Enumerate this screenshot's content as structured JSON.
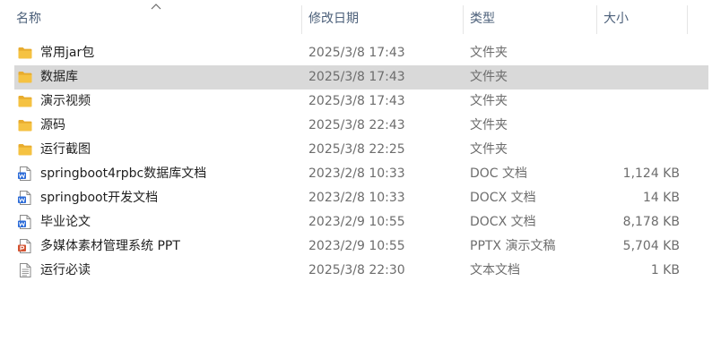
{
  "columns": {
    "name": "名称",
    "date": "修改日期",
    "type": "类型",
    "size": "大小"
  },
  "sort": {
    "column": "name",
    "direction": "ascending"
  },
  "colors": {
    "folder": "#f5c242",
    "word": "#2b6bd8",
    "ppt": "#d35230",
    "selected_row": "#d9d9d9",
    "header_text": "#4c607a"
  },
  "files": [
    {
      "name": "常用jar包",
      "date": "2025/3/8 17:43",
      "type": "文件夹",
      "size": "",
      "icon": "folder-icon",
      "selected": false
    },
    {
      "name": "数据库",
      "date": "2025/3/8 17:43",
      "type": "文件夹",
      "size": "",
      "icon": "folder-icon",
      "selected": true
    },
    {
      "name": "演示视频",
      "date": "2025/3/8 17:43",
      "type": "文件夹",
      "size": "",
      "icon": "folder-icon",
      "selected": false
    },
    {
      "name": "源码",
      "date": "2025/3/8 22:43",
      "type": "文件夹",
      "size": "",
      "icon": "folder-icon",
      "selected": false
    },
    {
      "name": "运行截图",
      "date": "2025/3/8 22:25",
      "type": "文件夹",
      "size": "",
      "icon": "folder-icon",
      "selected": false
    },
    {
      "name": "springboot4rpbc数据库文档",
      "date": "2023/2/8 10:33",
      "type": "DOC 文档",
      "size": "1,124 KB",
      "icon": "word-doc-icon",
      "selected": false
    },
    {
      "name": "springboot开发文档",
      "date": "2023/2/8 10:33",
      "type": "DOCX 文档",
      "size": "14 KB",
      "icon": "word-doc-icon",
      "selected": false
    },
    {
      "name": "毕业论文",
      "date": "2023/2/9 10:55",
      "type": "DOCX 文档",
      "size": "8,178 KB",
      "icon": "word-doc-icon",
      "selected": false
    },
    {
      "name": "多媒体素材管理系统 PPT",
      "date": "2023/2/9 10:55",
      "type": "PPTX 演示文稿",
      "size": "5,704 KB",
      "icon": "ppt-icon",
      "selected": false
    },
    {
      "name": "运行必读",
      "date": "2025/3/8 22:30",
      "type": "文本文档",
      "size": "1 KB",
      "icon": "text-doc-icon",
      "selected": false
    }
  ]
}
